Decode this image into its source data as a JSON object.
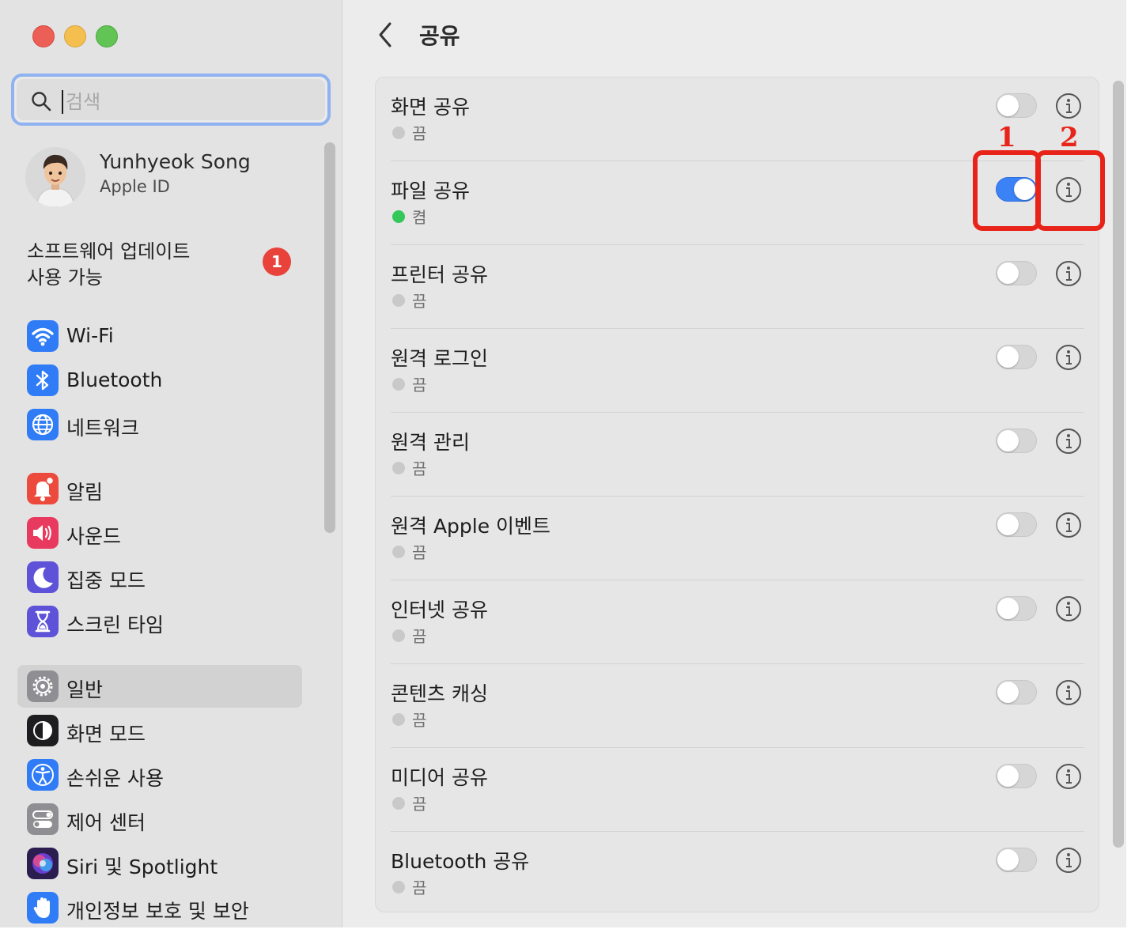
{
  "sidebar": {
    "search_placeholder": "검색",
    "profile": {
      "name": "Yunhyeok Song",
      "subtitle": "Apple ID"
    },
    "update": {
      "line1": "소프트웨어 업데이트",
      "line2": "사용 가능",
      "badge": "1"
    },
    "items": [
      {
        "label": "Wi-Fi",
        "icon": "wifi-icon",
        "color": "#2f7cf6"
      },
      {
        "label": "Bluetooth",
        "icon": "bluetooth-icon",
        "color": "#2f7cf6"
      },
      {
        "label": "네트워크",
        "icon": "globe-icon",
        "color": "#2f7cf6"
      },
      {
        "label": "알림",
        "icon": "bell-icon",
        "color": "#eb4a3d"
      },
      {
        "label": "사운드",
        "icon": "speaker-icon",
        "color": "#e83a5e"
      },
      {
        "label": "집중 모드",
        "icon": "moon-icon",
        "color": "#5e52d8"
      },
      {
        "label": "스크린 타임",
        "icon": "hourglass-icon",
        "color": "#5e52d8"
      },
      {
        "label": "일반",
        "icon": "gear-icon",
        "color": "#8e8e93",
        "active": true
      },
      {
        "label": "화면 모드",
        "icon": "appearance-icon",
        "color": "#1d1d1f"
      },
      {
        "label": "손쉬운 사용",
        "icon": "accessibility-icon",
        "color": "#2f7cf6"
      },
      {
        "label": "제어 센터",
        "icon": "control-center-icon",
        "color": "#8e8e93"
      },
      {
        "label": "Siri 및 Spotlight",
        "icon": "siri-icon",
        "color": "#6a3fd0"
      },
      {
        "label": "개인정보 보호 및 보안",
        "icon": "hand-icon",
        "color": "#2f7cf6"
      }
    ]
  },
  "main": {
    "title": "공유",
    "rows": [
      {
        "title": "화면 공유",
        "status": "끔",
        "on": false
      },
      {
        "title": "파일 공유",
        "status": "켬",
        "on": true
      },
      {
        "title": "프린터 공유",
        "status": "끔",
        "on": false
      },
      {
        "title": "원격 로그인",
        "status": "끔",
        "on": false
      },
      {
        "title": "원격 관리",
        "status": "끔",
        "on": false
      },
      {
        "title": "원격 Apple 이벤트",
        "status": "끔",
        "on": false
      },
      {
        "title": "인터넷 공유",
        "status": "끔",
        "on": false
      },
      {
        "title": "콘텐츠 캐싱",
        "status": "끔",
        "on": false
      },
      {
        "title": "미디어 공유",
        "status": "끔",
        "on": false
      },
      {
        "title": "Bluetooth 공유",
        "status": "끔",
        "on": false
      }
    ]
  },
  "annotations": {
    "label1": "1",
    "label2": "2",
    "color": "#e8241a"
  }
}
